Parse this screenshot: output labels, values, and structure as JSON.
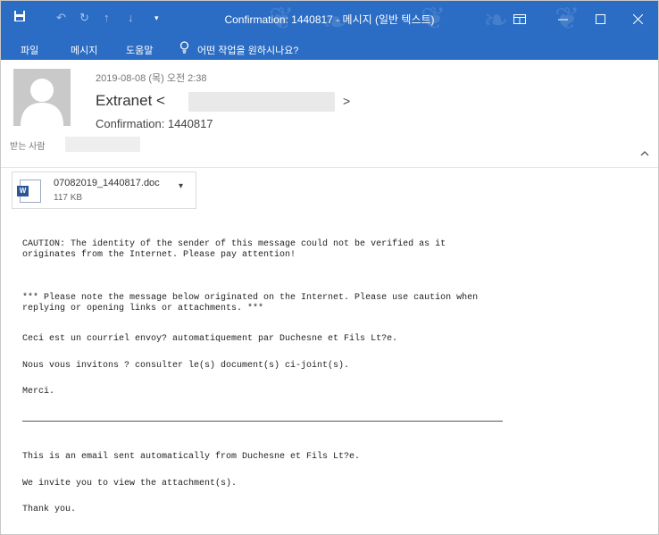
{
  "window": {
    "title": "Confirmation: 1440817  -  메시지 (일반 텍스트)",
    "quick_access": {
      "save_icon": "save-icon",
      "undo_icon": "undo-icon",
      "redo_icon": "redo-icon",
      "up_icon": "arrow-up-icon",
      "down_icon": "arrow-down-icon",
      "customize_icon": "customize-icon"
    },
    "controls": {
      "restore_icon": "ribbon-display-icon",
      "minimize_icon": "minimize-icon",
      "maximize_icon": "maximize-icon",
      "close_icon": "close-icon"
    }
  },
  "ribbon": {
    "tabs": [
      "파일",
      "메시지",
      "도움말"
    ],
    "tell_me": "어떤 작업을 원하시나요?",
    "tell_me_icon": "lightbulb-icon"
  },
  "message": {
    "date": "2019-08-08 (목) 오전 2:38",
    "sender_name": "Extranet <",
    "sender_close": ">",
    "subject": "Confirmation: 1440817",
    "to_label": "받는 사람",
    "collapse_icon": "chevron-up-icon"
  },
  "attachment": {
    "name": "07082019_1440817.doc",
    "size": "117 KB",
    "icon": "word-document-icon",
    "dropdown_icon": "chevron-down-icon"
  },
  "body": {
    "caution_line1": "CAUTION: The identity of the sender of this message could not be verified as it",
    "caution_line2": "originates from the Internet. Please pay attention!",
    "note_line1": "*** Please note the message below originated on the Internet. Please use caution when",
    "note_line2": "replying or opening links or attachments. ***",
    "fr_line1": "Ceci est un courriel envoy? automatiquement par Duchesne et Fils Lt?e.",
    "fr_line2": "Nous vous invitons ? consulter le(s) document(s) ci-joint(s).",
    "fr_line3": "Merci.",
    "en_line1": "This is an email sent automatically from Duchesne et Fils Lt?e.",
    "en_line2": "We invite you to view the attachment(s).",
    "en_line3": "Thank you."
  }
}
